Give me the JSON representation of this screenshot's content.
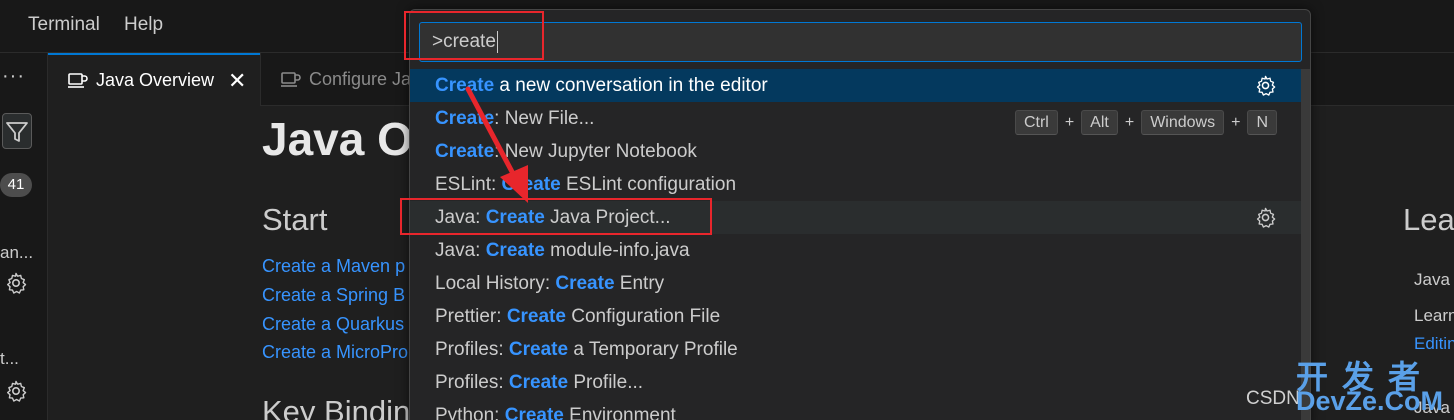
{
  "menu": {
    "terminal": "Terminal",
    "help": "Help"
  },
  "sidebar": {
    "more": "···",
    "badge": "41",
    "item1": "an...",
    "item2": "t..."
  },
  "tabs": [
    {
      "label": "Java Overview",
      "close": "✕"
    },
    {
      "label": "Configure Ja"
    }
  ],
  "editor": {
    "title": "Java Ov",
    "start_heading": "Start",
    "links": [
      "Create a Maven p",
      "Create a Spring B",
      "Create a Quarkus",
      "Create a MicroPro"
    ],
    "key_heading": "Key Bindin",
    "learn_heading": "Lear",
    "learn_items": [
      "Java",
      "Learn",
      "Editin",
      "Java"
    ]
  },
  "quickpick": {
    "input_value": ">create",
    "items": [
      {
        "pre": "",
        "hl": "Create",
        "post": " a new conversation in the editor",
        "gear": true,
        "selected": true
      },
      {
        "pre": "",
        "hl": "Create",
        "post": ": New File...",
        "keys": [
          "Ctrl",
          "Alt",
          "Windows",
          "N"
        ]
      },
      {
        "pre": "",
        "hl": "Create",
        "post": ": New Jupyter Notebook"
      },
      {
        "pre": "ESLint: ",
        "hl": "Create",
        "post": " ESLint configuration"
      },
      {
        "pre": "Java: ",
        "hl": "Create",
        "post": " Java Project...",
        "gear": true,
        "hover": true
      },
      {
        "pre": "Java: ",
        "hl": "Create",
        "post": " module-info.java"
      },
      {
        "pre": "Local History: ",
        "hl": "Create",
        "post": " Entry"
      },
      {
        "pre": "Prettier: ",
        "hl": "Create",
        "post": " Configuration File"
      },
      {
        "pre": "Profiles: ",
        "hl": "Create",
        "post": " a Temporary Profile"
      },
      {
        "pre": "Profiles: ",
        "hl": "Create",
        "post": " Profile..."
      },
      {
        "pre": "Python: ",
        "hl": "Create",
        "post": " Environment"
      }
    ]
  },
  "watermark": {
    "csdn": "CSDN",
    "cn": "开发者",
    "en": "DevZe.CoM"
  },
  "colors": {
    "accent": "#0078d4",
    "highlight": "#3794ff",
    "annotation": "#e8262c"
  }
}
